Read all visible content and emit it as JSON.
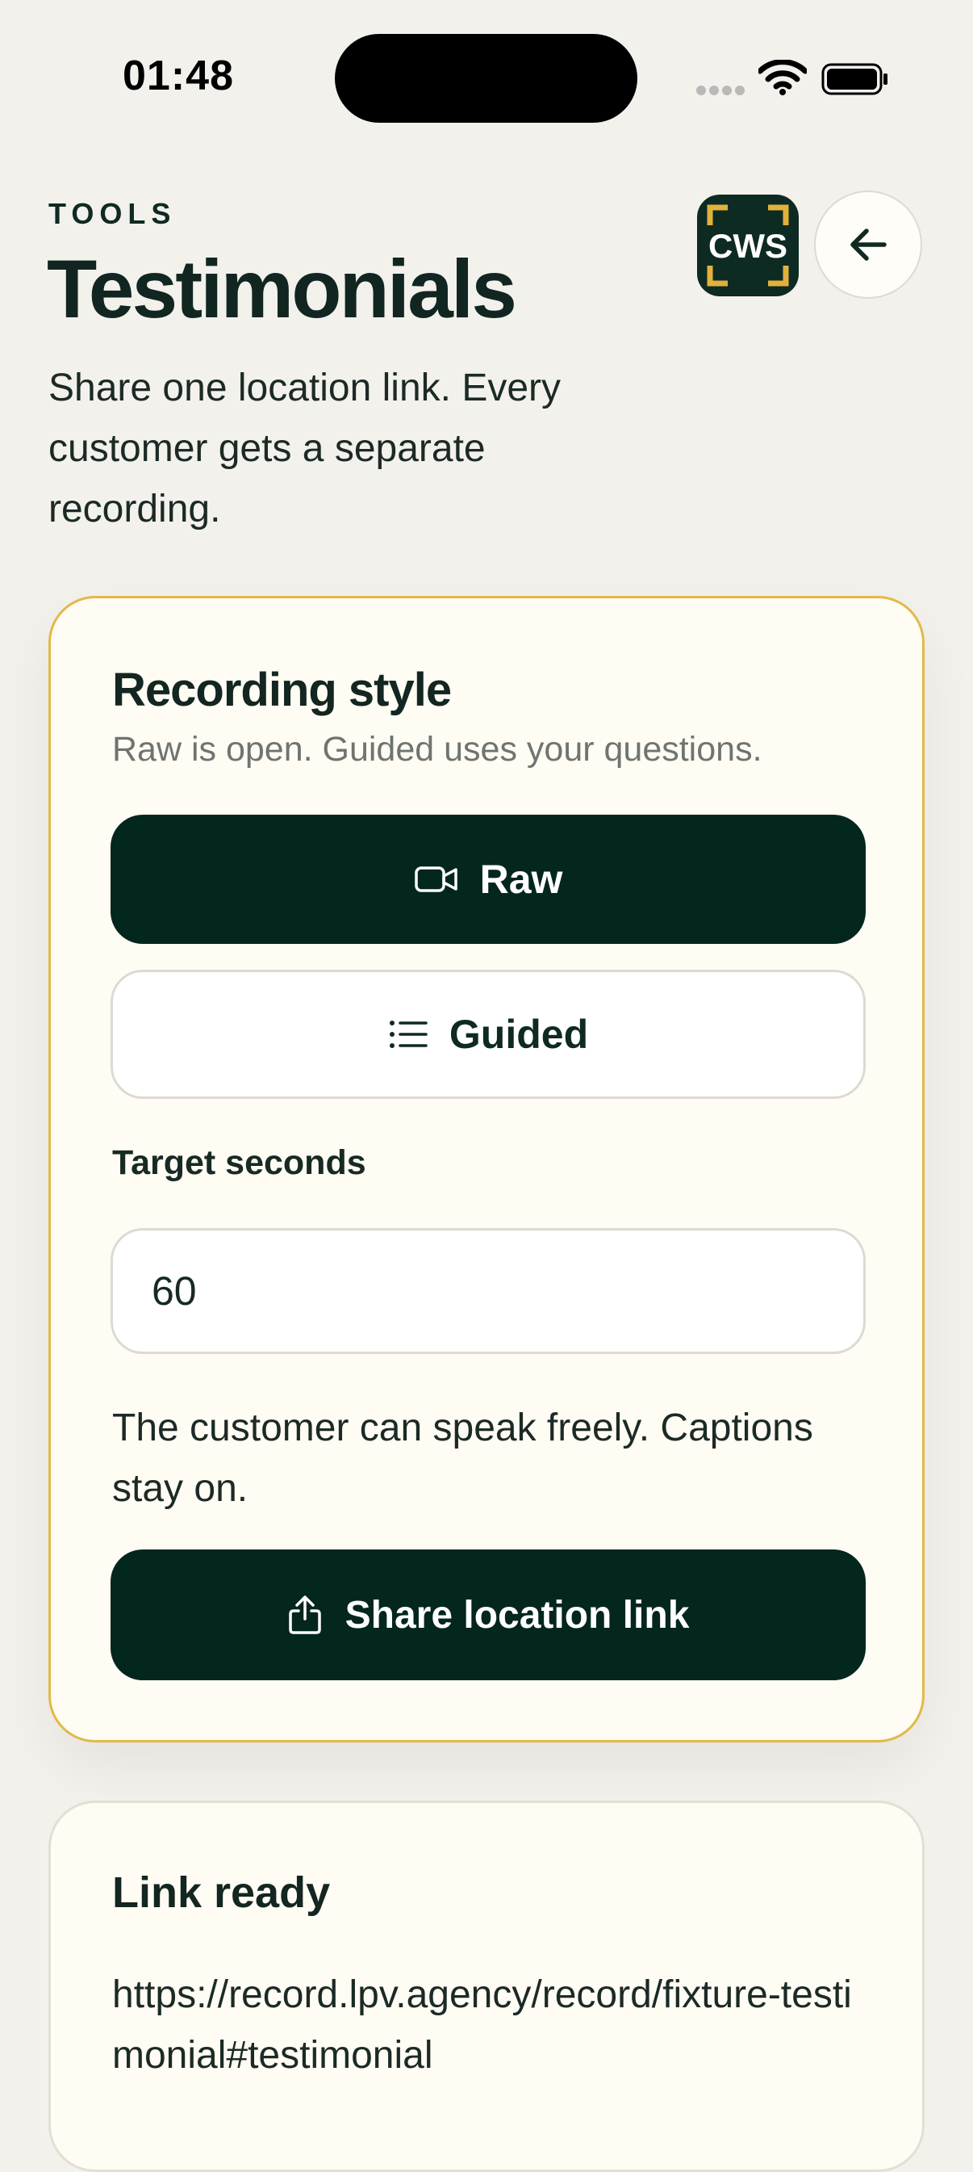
{
  "status_bar": {
    "time": "01:48"
  },
  "header": {
    "eyebrow": "TOOLS",
    "title": "Testimonials",
    "subtitle": "Share one location link. Every customer gets a separate recording.",
    "logo_text": "CWS",
    "back_icon": "arrow-left-icon"
  },
  "recording": {
    "title": "Recording style",
    "subtitle": "Raw is open. Guided uses your questions.",
    "options": [
      {
        "label": "Raw",
        "icon": "video-camera-icon",
        "selected": true
      },
      {
        "label": "Guided",
        "icon": "list-icon",
        "selected": false
      }
    ],
    "target_label": "Target seconds",
    "target_value": "60",
    "helper": "The customer can speak freely. Captions stay on.",
    "share_label": "Share location link",
    "share_icon": "share-icon"
  },
  "link_card": {
    "title": "Link ready",
    "url": "https://record.lpv.agency/record/fixture-testimonial#testimonial"
  },
  "colors": {
    "background": "#f3f1ec",
    "primary": "#03261f",
    "card": "#fffcf4",
    "accent_border": "#e2b949",
    "logo_corner": "#e2b13c"
  }
}
